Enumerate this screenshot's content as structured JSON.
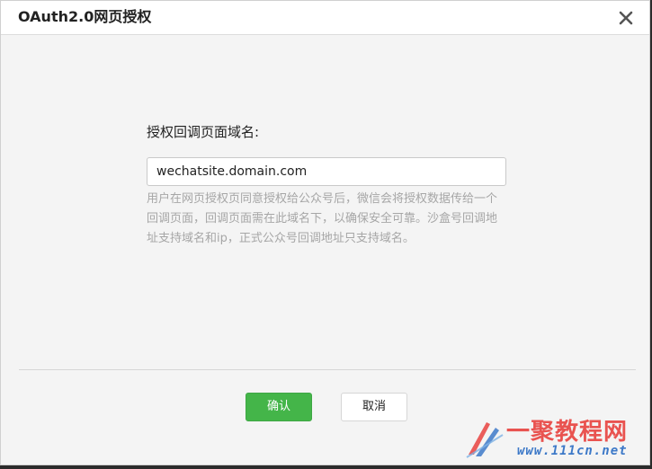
{
  "dialog": {
    "title": "OAuth2.0网页授权",
    "close_icon": "close-icon"
  },
  "form": {
    "label": "授权回调页面域名:",
    "domain_value": "wechatsite.domain.com",
    "hint": "用户在网页授权页同意授权给公众号后，微信会将授权数据传给一个回调页面，回调页面需在此域名下，以确保安全可靠。沙盒号回调地址支持域名和ip，正式公众号回调地址只支持域名。"
  },
  "buttons": {
    "confirm": "确认",
    "cancel": "取消"
  },
  "watermark": {
    "text": "一聚教程网",
    "url": "www.111cn.net"
  },
  "colors": {
    "primary": "#44b549",
    "watermark_red": "#e8423f",
    "watermark_blue": "#3d79c8"
  }
}
